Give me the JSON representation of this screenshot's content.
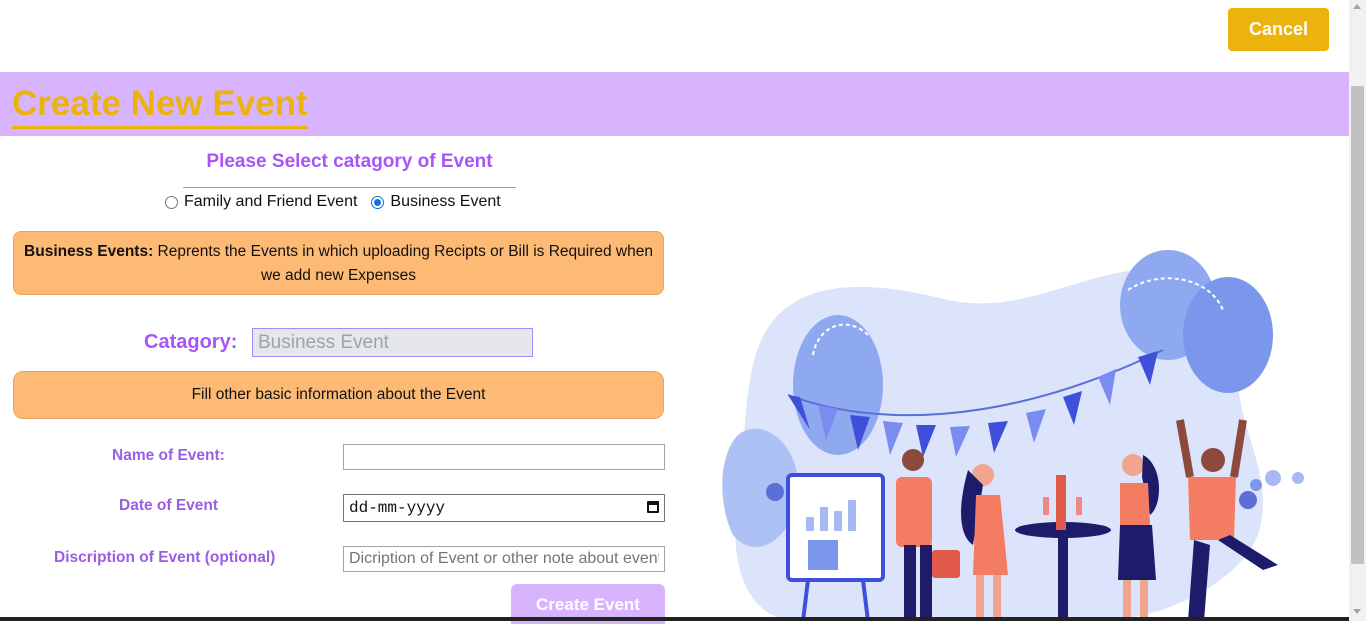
{
  "header": {
    "cancel_label": "Cancel",
    "title": "Create New Event"
  },
  "category_select": {
    "heading": "Please Select catagory of Event",
    "options": [
      {
        "label": "Family and Friend Event",
        "checked": false
      },
      {
        "label": "Business Event",
        "checked": true
      }
    ]
  },
  "info": {
    "bold": "Business Events:",
    "text": " Reprents the Events in which uploading Recipts or Bill is Required when we add new Expenses"
  },
  "category": {
    "label": "Catagory:",
    "value": "Business Event"
  },
  "fill_info": "Fill other basic information about the Event",
  "form": {
    "name_label": "Name of Event:",
    "name_value": "",
    "date_label": "Date of Event",
    "date_value": "dd-mm-yyyy",
    "desc_label": "Discription of Event (optional)",
    "desc_placeholder": "Dicription of Event or other note about event",
    "submit_label": "Create Event"
  },
  "colors": {
    "accent": "#ebb30b",
    "purple": "#a855f7",
    "banner": "#d8b4fe",
    "info_bg": "#fdba74",
    "radio_checked": "#0b72e7"
  },
  "illustration": {
    "icon": "party-illustration"
  }
}
